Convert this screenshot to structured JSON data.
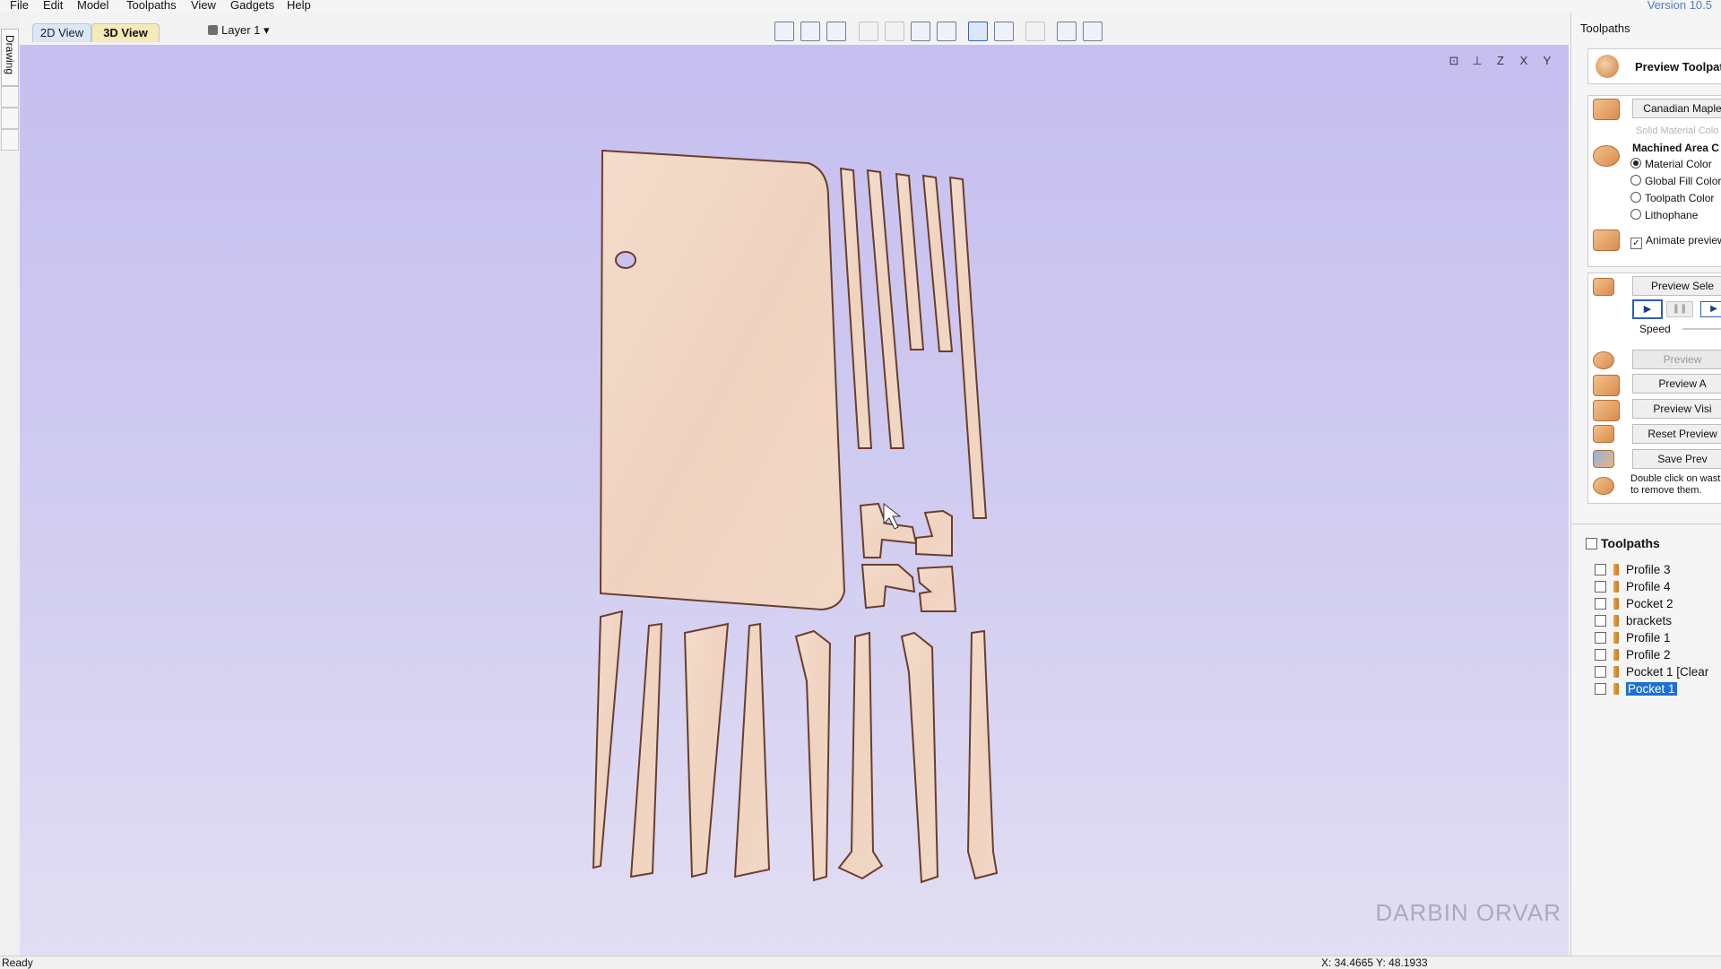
{
  "menu": {
    "items": [
      "File",
      "Edit",
      "Model",
      "Toolpaths",
      "View",
      "Gadgets",
      "Help"
    ],
    "version": "Version 10.5"
  },
  "left_strip": {
    "drawing_tab": "Drawing"
  },
  "view_tabs": {
    "tab_2d": "2D View",
    "tab_3d": "3D View"
  },
  "layer": {
    "label": "Layer 1"
  },
  "toolbar_icons": [
    "wireframe-icon",
    "shaded-icon",
    "grid-icon",
    "snap-icon",
    "zoom-icon",
    "zoom-box-icon",
    "zoom-fit-icon",
    "render-icon",
    "toolpath-view-icon",
    "lamp-icon",
    "split-h-icon",
    "split-v-icon"
  ],
  "viewport": {
    "view_icons": [
      "fit-view-icon",
      "iso-view-icon",
      "z-view-icon",
      "x-view-icon",
      "y-view-icon"
    ],
    "view_icon_labels": [
      "",
      "",
      "Z",
      "X",
      "Y"
    ],
    "watermark": "DARBIN ORVAR"
  },
  "right_panel": {
    "title": "Toolpaths",
    "preview_title": "Preview Toolpat",
    "material_button": "Canadian Maple",
    "solid_material_color": "Solid Material Colo",
    "machined_area": "Machined Area C",
    "radio_options": [
      {
        "label": "Material Color",
        "selected": true
      },
      {
        "label": "Global Fill Color",
        "selected": false
      },
      {
        "label": "Toolpath Color",
        "selected": false
      },
      {
        "label": "Lithophane",
        "selected": false
      }
    ],
    "animate_preview": "Animate preview",
    "preview_selected": "Preview Sele",
    "speed_label": "Speed",
    "preview_button": "Preview",
    "preview_all": "Preview A",
    "preview_visible": "Preview Visi",
    "reset_preview": "Reset Preview",
    "save_preview": "Save Prev",
    "hint_line1": "Double click on wast",
    "hint_line2": "to remove them."
  },
  "toolpaths": {
    "header": "Toolpaths",
    "items": [
      {
        "label": "Profile 3",
        "selected": false
      },
      {
        "label": "Profile 4",
        "selected": false
      },
      {
        "label": "Pocket 2",
        "selected": false
      },
      {
        "label": "brackets",
        "selected": false
      },
      {
        "label": "Profile 1",
        "selected": false
      },
      {
        "label": "Profile 2",
        "selected": false
      },
      {
        "label": "Pocket 1 [Clear",
        "selected": false
      },
      {
        "label": "Pocket 1",
        "selected": true
      }
    ]
  },
  "status": {
    "left": "Ready",
    "coords": "X: 34.4665 Y: 48.1933"
  },
  "colors": {
    "wood": "#f1d6c4",
    "wood_edge": "#6b3d2e",
    "accent_blue": "#1f6fd1"
  }
}
